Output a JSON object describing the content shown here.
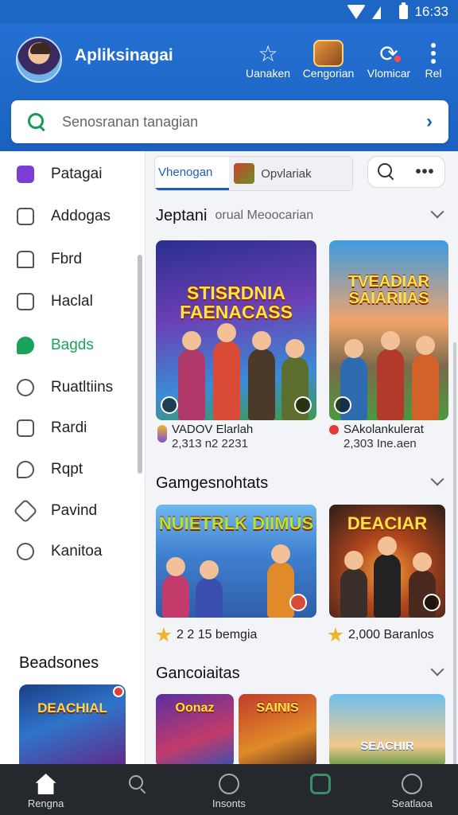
{
  "status_bar": {
    "time": "16:33"
  },
  "header": {
    "title": "Apliksinagai",
    "actions": [
      {
        "label": "Uanaken",
        "icon": "star-icon"
      },
      {
        "label": "Cengorian",
        "icon": "game-thumbnail-icon"
      },
      {
        "label": "Vlomicar",
        "icon": "refresh-circle-icon"
      },
      {
        "label": "Rel",
        "icon": "more-vertical-icon"
      }
    ]
  },
  "search": {
    "placeholder": "Senosranan tanagian"
  },
  "sidebar": {
    "items": [
      {
        "label": "Patagai"
      },
      {
        "label": "Addogas"
      },
      {
        "label": "Fbrd"
      },
      {
        "label": "Haclal"
      },
      {
        "label": "Bagds"
      },
      {
        "label": "Ruatltiins"
      },
      {
        "label": "Rardi"
      },
      {
        "label": "Rqpt"
      },
      {
        "label": "Pavind"
      },
      {
        "label": "Kanitoa"
      }
    ],
    "active_index": 4,
    "section_title": "Beadsones",
    "promo_title": "DEACHIAL"
  },
  "main": {
    "tabs": [
      {
        "label": "Vhenogan"
      },
      {
        "label": "Opvlariak"
      }
    ],
    "sections": [
      {
        "title": "Jeptani",
        "subtitle": "orual Meoocarian",
        "cards": [
          {
            "art_title": "STISRDNIA FAENACASS",
            "name": "VADOV Elarlah",
            "meta": "2,313 n2 2231"
          },
          {
            "art_title": "TVEADIAR SAIARIIAS",
            "name": "SAkolankulerat",
            "meta": "2,303 Ine.aen"
          }
        ]
      },
      {
        "title": "Gamgesnohtats",
        "cards": [
          {
            "art_title": "NUIETRLK DIIMUS",
            "meta": "2 2 15 bemgia"
          },
          {
            "art_title": "DEACIAR",
            "meta": "2,000 Baranlos"
          }
        ]
      },
      {
        "title": "Gancoiaitas",
        "cards": [
          {
            "art_title": "Oonaz"
          },
          {
            "art_title": "SAINIS"
          },
          {
            "art_title": "SEACHIR"
          }
        ]
      }
    ]
  },
  "bottom_nav": [
    {
      "label": "Rengna",
      "icon": "home-icon"
    },
    {
      "label": "",
      "icon": "search-icon"
    },
    {
      "label": "Insonts",
      "icon": "circle-icon"
    },
    {
      "label": "",
      "icon": "square-icon"
    },
    {
      "label": "Seatlaoa",
      "icon": "clock-icon"
    }
  ],
  "colors": {
    "primary": "#1e66c4",
    "accent": "#1aa35a",
    "nav_bg": "#25282d"
  }
}
